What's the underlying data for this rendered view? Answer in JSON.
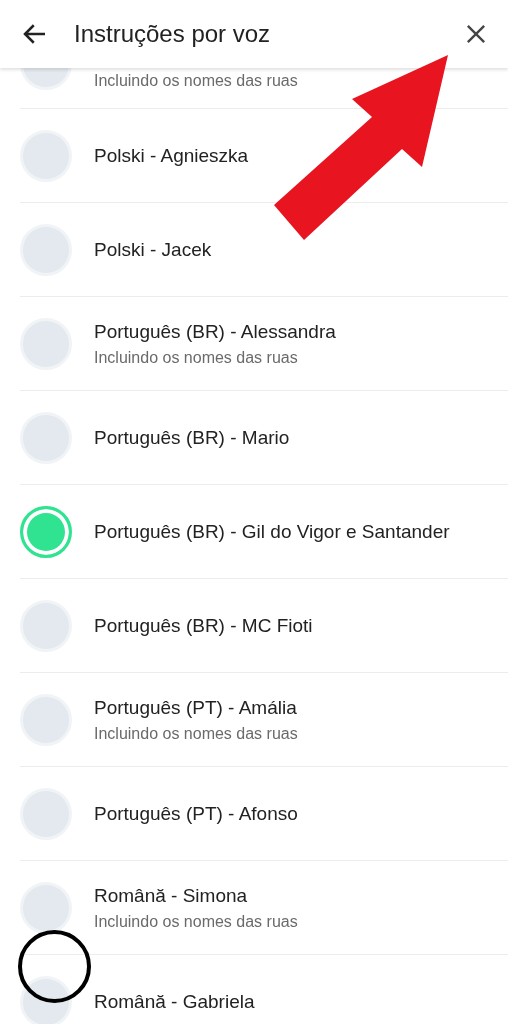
{
  "header": {
    "title": "Instruções por voz"
  },
  "voices": [
    {
      "subtitle": "Incluindo os nomes das ruas",
      "selected": false
    },
    {
      "title": "Polski - Agnieszka",
      "selected": false
    },
    {
      "title": "Polski - Jacek",
      "selected": false
    },
    {
      "title": "Português (BR) - Alessandra",
      "subtitle": "Incluindo os nomes das ruas",
      "selected": false
    },
    {
      "title": "Português (BR) - Mario",
      "selected": false
    },
    {
      "title": "Português (BR) - Gil do Vigor e Santander",
      "selected": true
    },
    {
      "title": "Português (BR) - MC Fioti",
      "selected": false
    },
    {
      "title": "Português (PT) - Amália",
      "subtitle": "Incluindo os nomes das ruas",
      "selected": false
    },
    {
      "title": "Português (PT) - Afonso",
      "selected": false
    },
    {
      "title": "Română - Simona",
      "subtitle": "Incluindo os nomes das ruas",
      "selected": false
    },
    {
      "title": "Română - Gabriela",
      "selected": false
    }
  ]
}
